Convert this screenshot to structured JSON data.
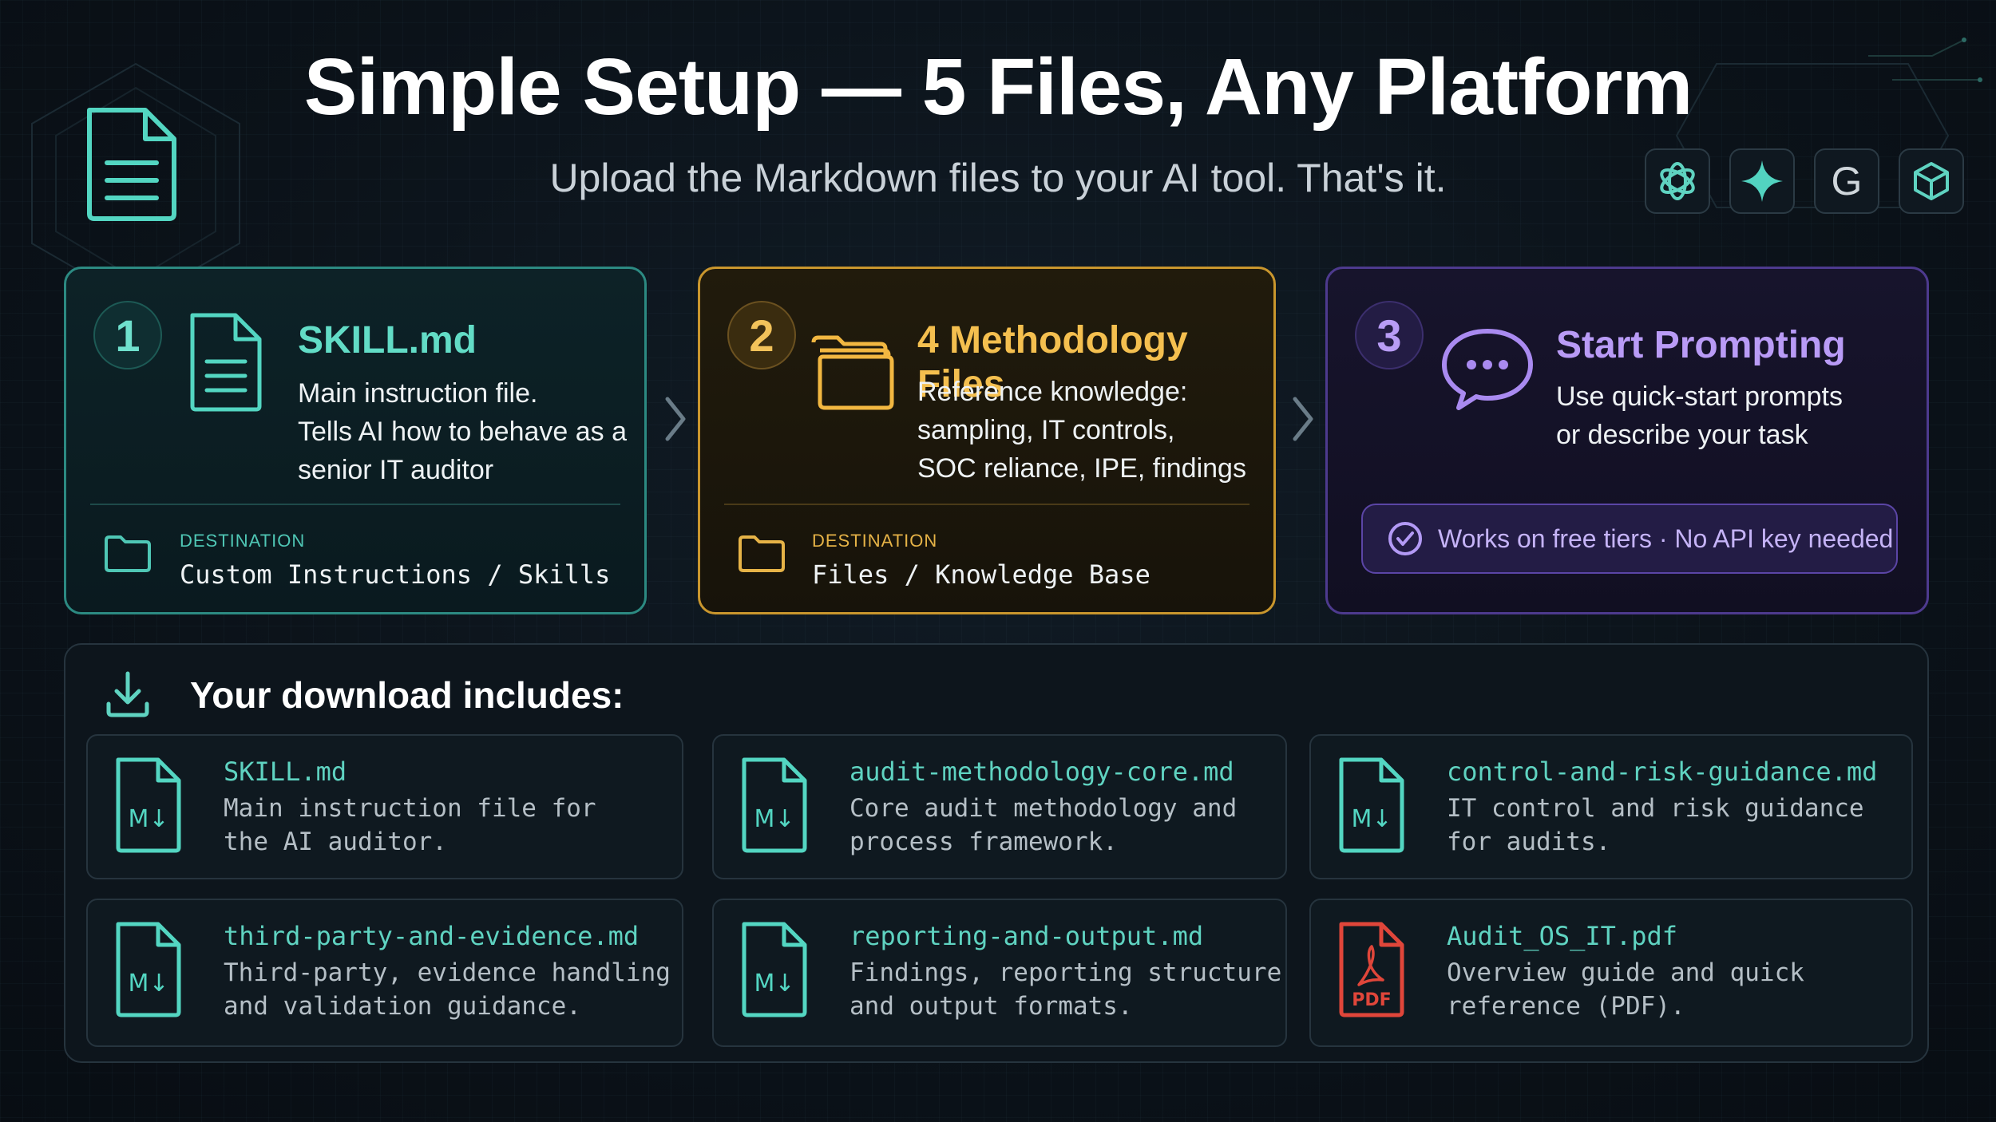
{
  "header": {
    "title": "Simple Setup — 5 Files, Any Platform",
    "subtitle": "Upload the Markdown files to your AI tool. That's it."
  },
  "platforms": [
    {
      "icon": "openai-icon"
    },
    {
      "icon": "sparkle-icon"
    },
    {
      "icon": "google-icon",
      "label": "G"
    },
    {
      "icon": "cube-icon"
    }
  ],
  "steps": [
    {
      "number": "1",
      "title": "SKILL.md",
      "description": "Main instruction file.\nTells AI how to behave as a senior IT auditor",
      "destination_label": "DESTINATION",
      "destination_value": "Custom Instructions / Skills",
      "color": "#62dcc6"
    },
    {
      "number": "2",
      "title": "4 Methodology Files",
      "description": "Reference knowledge:\nsampling, IT controls,\nSOC reliance, IPE, findings",
      "destination_label": "DESTINATION",
      "destination_value": "Files / Knowledge Base",
      "color": "#f4bf4f"
    },
    {
      "number": "3",
      "title": "Start Prompting",
      "description": "Use quick-start prompts\nor describe your task",
      "badge": "Works on free tiers · No API key needed",
      "color": "#b99bf6"
    }
  ],
  "downloads": {
    "title": "Your download includes:",
    "files": [
      {
        "name": "SKILL.md",
        "description": "Main instruction file for\nthe AI auditor.",
        "icon_label": "M↓"
      },
      {
        "name": "audit-methodology-core.md",
        "description": "Core audit methodology and\nprocess framework.",
        "icon_label": "M↓"
      },
      {
        "name": "control-and-risk-guidance.md",
        "description": "IT control and risk guidance\nfor audits.",
        "icon_label": "M↓"
      },
      {
        "name": "third-party-and-evidence.md",
        "description": "Third-party, evidence handling\nand validation guidance.",
        "icon_label": "M↓"
      },
      {
        "name": "reporting-and-output.md",
        "description": "Findings, reporting structure\nand output formats.",
        "icon_label": "M↓"
      },
      {
        "name": "Audit_OS_IT.pdf",
        "description": "Overview guide and quick\nreference (PDF).",
        "icon_label": "PDF"
      }
    ]
  }
}
